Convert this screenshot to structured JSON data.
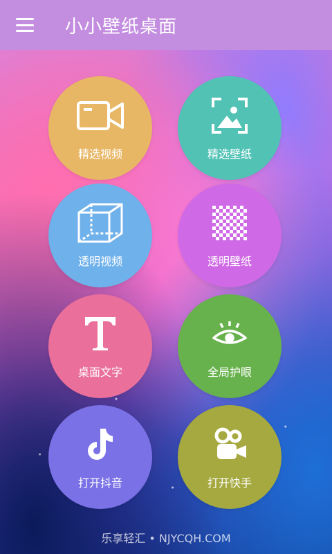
{
  "header": {
    "title": "小小壁纸桌面",
    "menu_icon": "menu-icon"
  },
  "tiles": [
    {
      "label": "精选视频",
      "icon": "video-camera-icon",
      "color": "#e8b766"
    },
    {
      "label": "精选壁纸",
      "icon": "image-frame-icon",
      "color": "#52c2b5"
    },
    {
      "label": "透明视频",
      "icon": "transparent-cube-icon",
      "color": "#6fb1ea"
    },
    {
      "label": "透明壁纸",
      "icon": "checkerboard-icon",
      "color": "#cf69e6"
    },
    {
      "label": "桌面文字",
      "icon": "text-t-icon",
      "color": "#ea6f9b"
    },
    {
      "label": "全局护眼",
      "icon": "eye-icon",
      "color": "#67b24d"
    },
    {
      "label": "打开抖音",
      "icon": "tiktok-note-icon",
      "color": "#7a71e6"
    },
    {
      "label": "打开快手",
      "icon": "kuaishou-camera-icon",
      "color": "#a6a93f"
    }
  ],
  "footer": {
    "watermark": "乐享轻汇 • NJYCQH.COM"
  }
}
